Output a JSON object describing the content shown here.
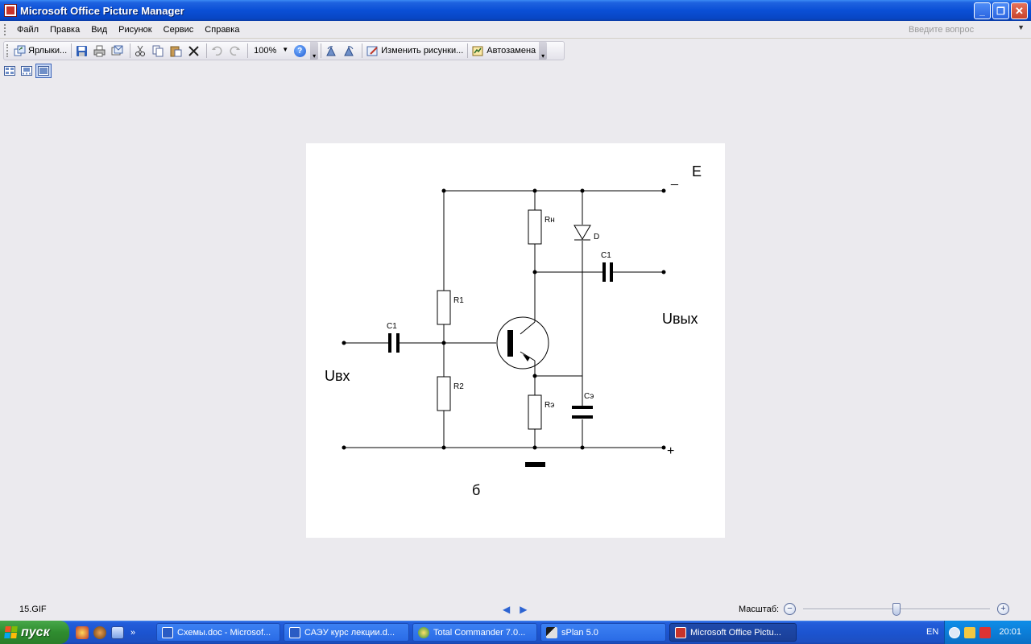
{
  "window": {
    "title": "Microsoft Office Picture Manager",
    "minimize": "_",
    "maximize": "❐",
    "close": "✕"
  },
  "menu": {
    "items": [
      "Файл",
      "Правка",
      "Вид",
      "Рисунок",
      "Сервис",
      "Справка"
    ],
    "help_placeholder": "Введите вопрос"
  },
  "toolbar": {
    "shortcuts_label": "Ярлыки...",
    "zoom_value": "100%",
    "help_glyph": "?",
    "edit_pictures_label": "Изменить рисунки...",
    "autocorrect_label": "Автозамена"
  },
  "circuit": {
    "labels": {
      "E": "E",
      "minus": "_",
      "plus": "+",
      "Rn": "Rн",
      "D": "D",
      "C1_out": "C1",
      "C1_in": "C1",
      "R1": "R1",
      "R2": "R2",
      "Re": "Rэ",
      "Ce": "Cэ",
      "Uvyx": "Uвых",
      "Uvx": "Uвх",
      "caption": "б"
    }
  },
  "status": {
    "filename": "15.GIF",
    "zoom_label": "Масштаб:",
    "zoom_minus": "−",
    "zoom_plus": "+",
    "zoom_fraction": 0.5
  },
  "taskbar": {
    "start_label": "пуск",
    "quicklaunch_more": "»",
    "tasks": [
      "Схемы.doc - Microsof...",
      "САЭУ курс лекции.d...",
      "Total Commander 7.0...",
      "sPlan 5.0",
      "Microsoft Office Pictu..."
    ],
    "language": "EN",
    "clock": "20:01"
  }
}
